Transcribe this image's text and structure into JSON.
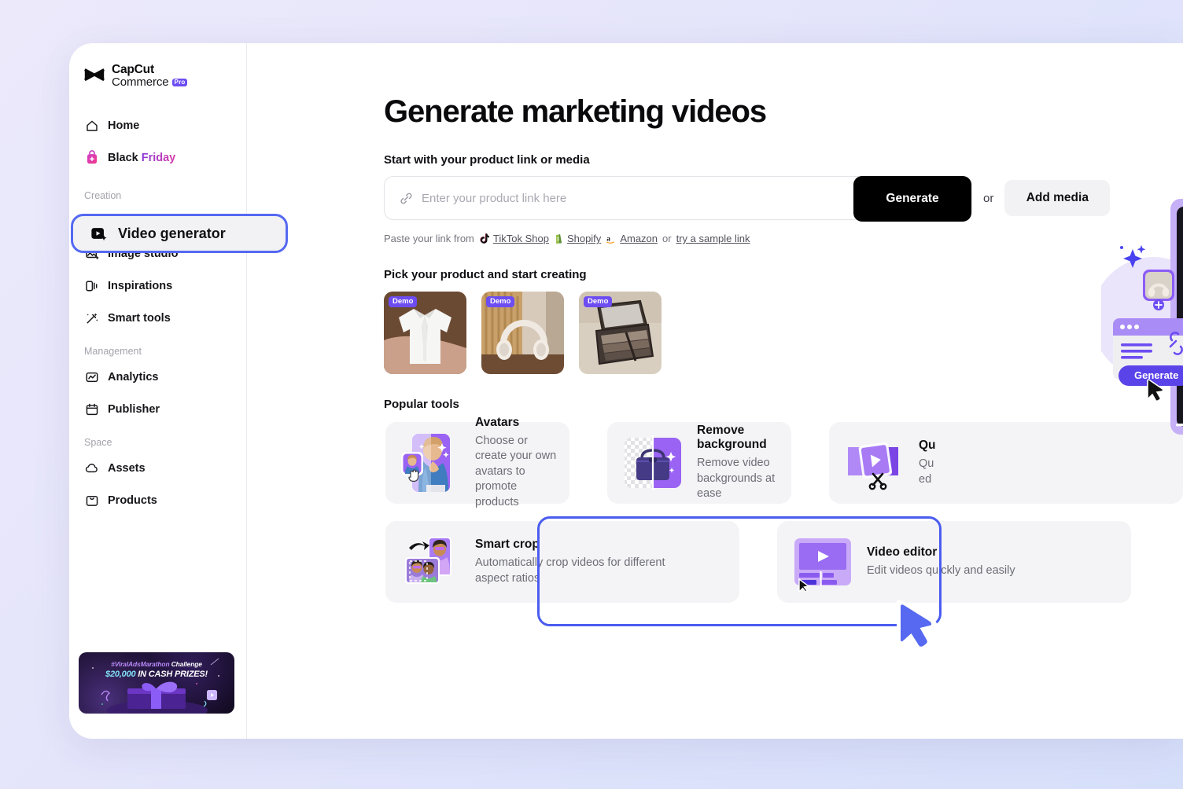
{
  "sidebar": {
    "logo": {
      "line1": "CapCut",
      "line2": "Commerce",
      "badge": "Pro"
    },
    "top_items": [
      {
        "label": "Home",
        "icon": "home-icon"
      },
      {
        "label_plain": "Black",
        "label_accent": "Friday",
        "icon": "shopping-bag-icon"
      }
    ],
    "groups": [
      {
        "title": "Creation",
        "items": [
          {
            "label": "Video generator",
            "icon": "video-generator-icon",
            "active": true
          },
          {
            "label": "Image studio",
            "icon": "image-studio-icon"
          },
          {
            "label": "Inspirations",
            "icon": "inspirations-icon"
          },
          {
            "label": "Smart tools",
            "icon": "magic-wand-icon"
          }
        ]
      },
      {
        "title": "Management",
        "items": [
          {
            "label": "Analytics",
            "icon": "analytics-icon"
          },
          {
            "label": "Publisher",
            "icon": "calendar-icon"
          }
        ]
      },
      {
        "title": "Space",
        "items": [
          {
            "label": "Assets",
            "icon": "cloud-icon"
          },
          {
            "label": "Products",
            "icon": "product-box-icon"
          }
        ]
      }
    ],
    "promo": {
      "line1_accent": "#ViralAdsMarathon",
      "line1_plain": " Challenge",
      "line2_accent": "$20,000",
      "line2_plain": " IN CASH PRIZES!"
    }
  },
  "main": {
    "title": "Generate marketing videos",
    "start_label": "Start with your product link or media",
    "link_input": {
      "placeholder": "Enter your product link here",
      "value": ""
    },
    "generate_label": "Generate",
    "or_label": "or",
    "add_media_label": "Add media",
    "paste": {
      "prefix": "Paste your link from",
      "sources": [
        {
          "name": "TikTok Shop",
          "icon": "tiktok-icon"
        },
        {
          "name": "Shopify",
          "icon": "shopify-icon"
        },
        {
          "name": "Amazon",
          "icon": "amazon-icon"
        }
      ],
      "or": "or",
      "sample_link": "try a sample link"
    },
    "pick_label": "Pick your product and start creating",
    "products": [
      {
        "badge": "Demo",
        "name": "white-shirt"
      },
      {
        "badge": "Demo",
        "name": "headphones"
      },
      {
        "badge": "Demo",
        "name": "eyeshadow-palette"
      }
    ],
    "tools_label": "Popular tools",
    "tools": [
      {
        "name": "Avatars",
        "desc": "Choose or create your own avatars to promote products",
        "icon": "avatars-icon",
        "highlighted": true
      },
      {
        "name": "Remove background",
        "desc": "Remove video backgrounds at ease",
        "icon": "remove-background-icon"
      },
      {
        "name": "Qu",
        "desc_line1": "Qu",
        "desc_line2": "ed",
        "icon": "quick-cut-icon",
        "truncated": true
      },
      {
        "name": "Smart crop",
        "desc": "Automatically crop videos for different aspect ratios",
        "icon": "smart-crop-icon"
      },
      {
        "name": "Video editor",
        "desc": "Edit videos quickly and easily",
        "icon": "video-editor-icon"
      }
    ]
  },
  "decoration": {
    "generate_label": "Generate"
  },
  "colors": {
    "accent_blue": "#4a5cf0",
    "purple": "#6d4df2",
    "black": "#000000",
    "card_bg": "#f4f4f6"
  }
}
